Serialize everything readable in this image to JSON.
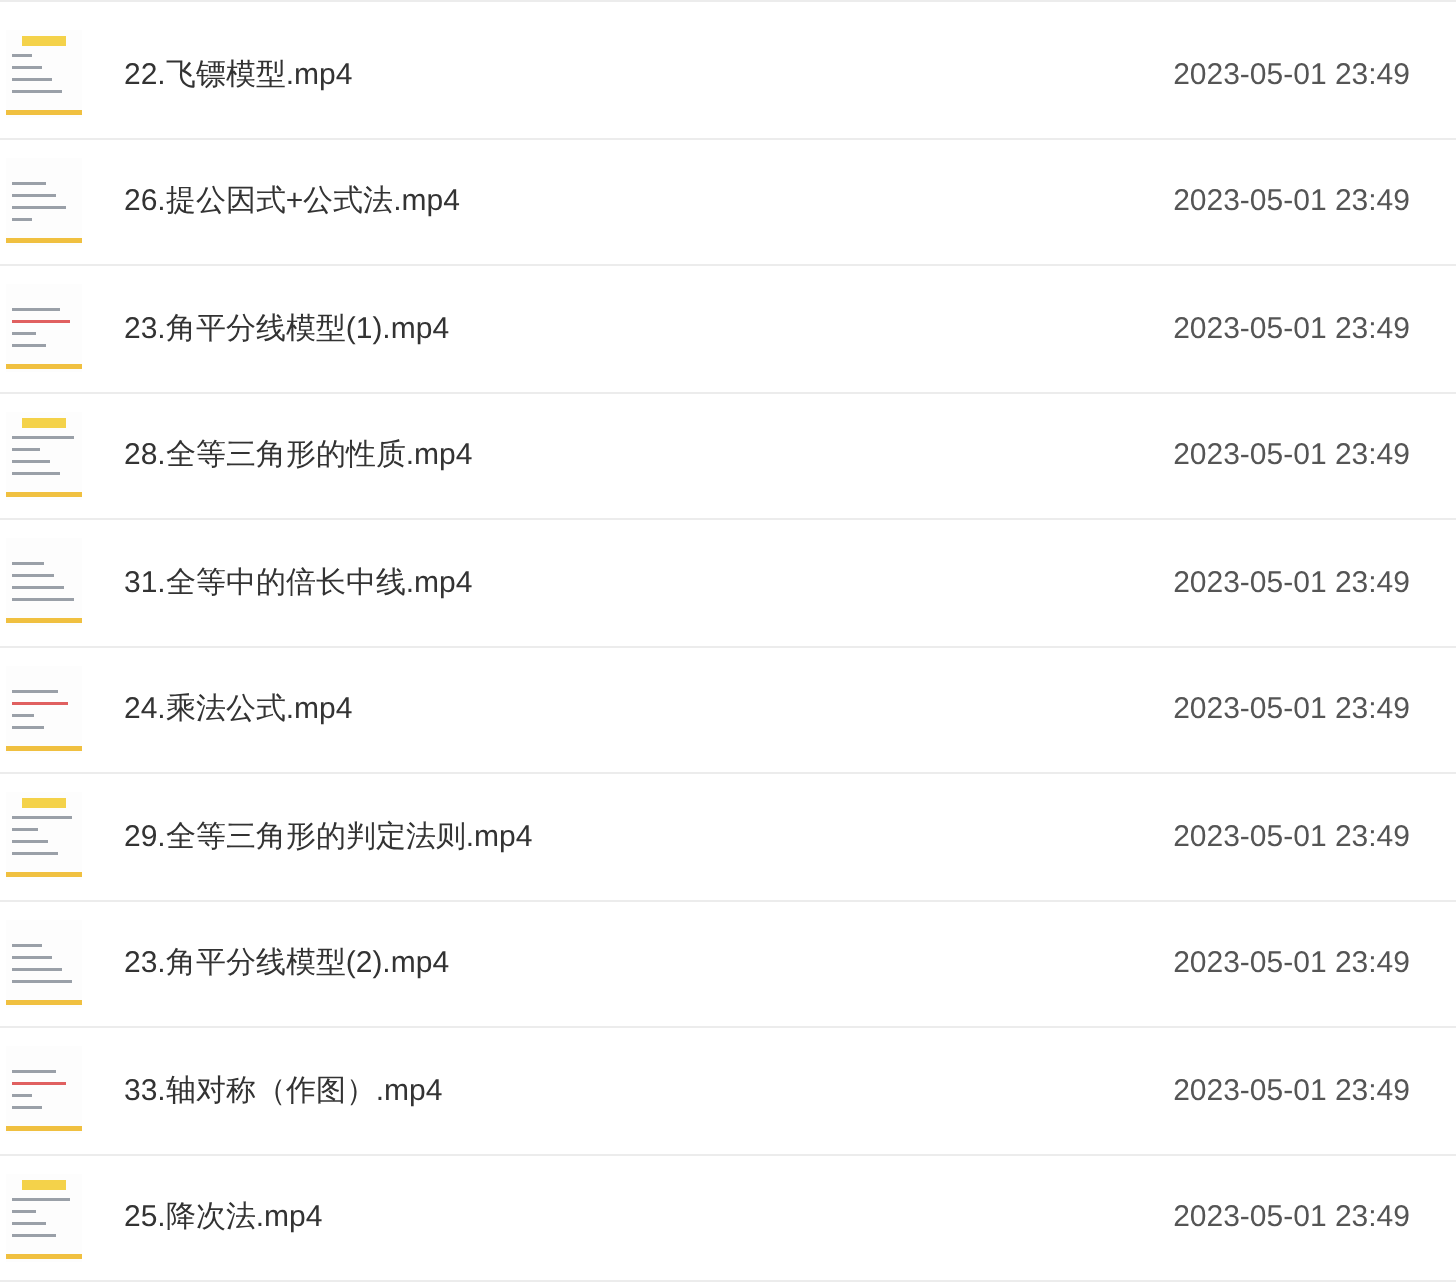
{
  "files": [
    {
      "name": "22.飞镖模型.mp4",
      "date": "2023-05-01 23:49"
    },
    {
      "name": "26.提公因式+公式法.mp4",
      "date": "2023-05-01 23:49"
    },
    {
      "name": "23.角平分线模型(1).mp4",
      "date": "2023-05-01 23:49"
    },
    {
      "name": "28.全等三角形的性质.mp4",
      "date": "2023-05-01 23:49"
    },
    {
      "name": "31.全等中的倍长中线.mp4",
      "date": "2023-05-01 23:49"
    },
    {
      "name": "24.乘法公式.mp4",
      "date": "2023-05-01 23:49"
    },
    {
      "name": "29.全等三角形的判定法则.mp4",
      "date": "2023-05-01 23:49"
    },
    {
      "name": "23.角平分线模型(2).mp4",
      "date": "2023-05-01 23:49"
    },
    {
      "name": "33.轴对称（作图）.mp4",
      "date": "2023-05-01 23:49"
    },
    {
      "name": "25.降次法.mp4",
      "date": "2023-05-01 23:49"
    }
  ]
}
